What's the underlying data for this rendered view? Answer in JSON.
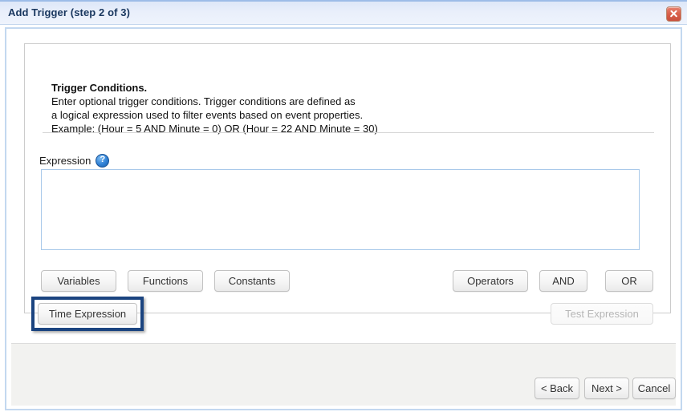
{
  "window": {
    "title": "Add Trigger (step 2 of 3)",
    "close_icon": "close-icon"
  },
  "panel": {
    "heading": "Trigger Conditions.",
    "description_lines": [
      "Enter optional trigger conditions. Trigger conditions are defined as",
      "a logical expression used to filter events based on event properties.",
      "Example: (Hour = 5 AND Minute = 0) OR (Hour = 22 AND Minute = 30)"
    ],
    "expression": {
      "label": "Expression",
      "help_icon": "?",
      "value": "",
      "placeholder": ""
    },
    "buttons": {
      "variables": "Variables",
      "functions": "Functions",
      "constants": "Constants",
      "operators": "Operators",
      "and": "AND",
      "or": "OR",
      "time_expression": "Time Expression",
      "test_expression": "Test Expression"
    }
  },
  "footer": {
    "back": "< Back",
    "next": "Next >",
    "cancel": "Cancel"
  },
  "colors": {
    "title_text": "#18365e",
    "titlebar_bg": "#e9effb",
    "frame_border": "#c3d8f0",
    "highlight": "#1b4480",
    "close_button": "#d9604a",
    "help_icon": "#2f81d6",
    "footer_bg": "#f2f2f0"
  }
}
